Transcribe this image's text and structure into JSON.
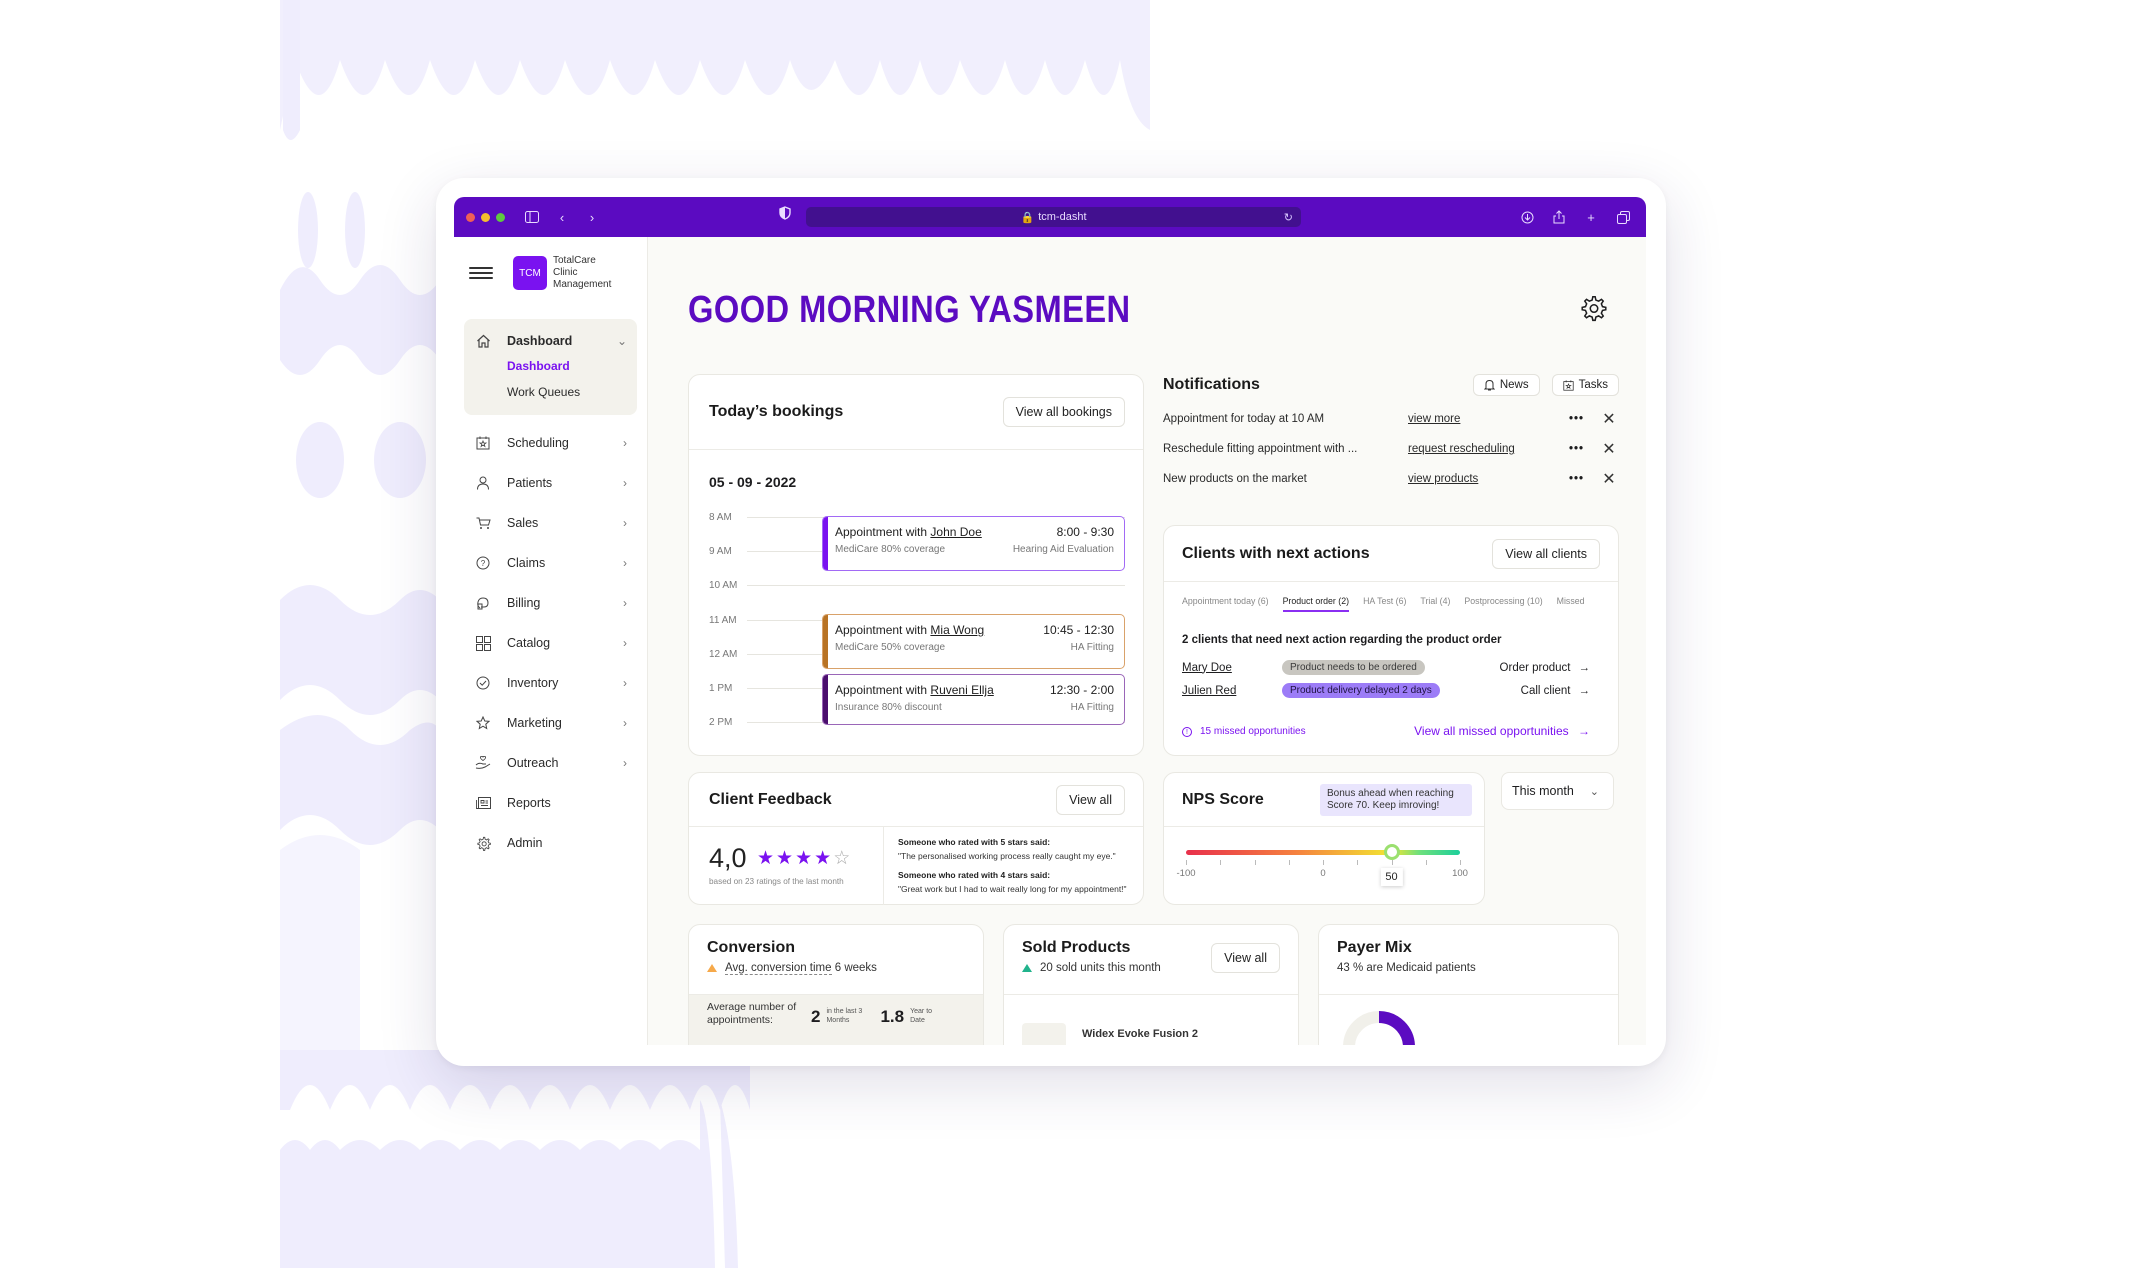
{
  "browser": {
    "url": "tcm-dasht",
    "traffic_lights": [
      "#ee5f57",
      "#f5bd2f",
      "#5fc841"
    ],
    "accent": "#5b0bc1"
  },
  "brand": {
    "logo_text": "TCM",
    "name_line1": "TotalCare",
    "name_line2": "Clinic",
    "name_line3": "Management"
  },
  "sidebar": {
    "group": {
      "label": "Dashboard",
      "icon": "home-icon",
      "children": [
        {
          "label": "Dashboard",
          "active": true
        },
        {
          "label": "Work Queues",
          "active": false
        }
      ]
    },
    "items": [
      {
        "label": "Scheduling",
        "icon": "calendar-star-icon",
        "chevron": true
      },
      {
        "label": "Patients",
        "icon": "person-icon",
        "chevron": true
      },
      {
        "label": "Sales",
        "icon": "cart-icon",
        "chevron": true
      },
      {
        "label": "Claims",
        "icon": "question-circle-icon",
        "chevron": true
      },
      {
        "label": "Billing",
        "icon": "billing-icon",
        "chevron": true
      },
      {
        "label": "Catalog",
        "icon": "grid-icon",
        "chevron": true
      },
      {
        "label": "Inventory",
        "icon": "check-circle-icon",
        "chevron": true
      },
      {
        "label": "Marketing",
        "icon": "star-icon",
        "chevron": true
      },
      {
        "label": "Outreach",
        "icon": "hand-heart-icon",
        "chevron": true
      },
      {
        "label": "Reports",
        "icon": "report-icon",
        "chevron": false
      },
      {
        "label": "Admin",
        "icon": "gear-icon",
        "chevron": false
      }
    ]
  },
  "header": {
    "greeting": "GOOD MORNING YASMEEN"
  },
  "bookings": {
    "title": "Today’s bookings",
    "view_all": "View all bookings",
    "date": "05 - 09 - 2022",
    "hours": [
      "8 AM",
      "9 AM",
      "10 AM",
      "11 AM",
      "12 AM",
      "1 PM",
      "2 PM"
    ],
    "appointments": [
      {
        "prefix": "Appointment with",
        "name": "John Doe",
        "time": "8:00 - 9:30",
        "coverage": "MediCare 80% coverage",
        "type": "Hearing Aid Evaluation",
        "color": "#7a12f0",
        "border": "#a26af5"
      },
      {
        "prefix": "Appointment with",
        "name": "Mia Wong",
        "time": "10:45 - 12:30",
        "coverage": "MediCare 50% coverage",
        "type": "HA Fitting",
        "color": "#b87324",
        "border": "#d9a26a"
      },
      {
        "prefix": "Appointment with",
        "name": "Ruveni Ellja",
        "time": "12:30 - 2:00",
        "coverage": "Insurance 80% discount",
        "type": "HA Fitting",
        "color": "#4b0e6e",
        "border": "#9a66b8"
      }
    ]
  },
  "notifications": {
    "title": "Notifications",
    "news_label": "News",
    "tasks_label": "Tasks",
    "items": [
      {
        "text": "Appointment for today at 10 AM",
        "link": "view more"
      },
      {
        "text": "Reschedule fitting appointment with ...",
        "link": "request rescheduling"
      },
      {
        "text": "New products on the market",
        "link": "view products"
      }
    ]
  },
  "clients": {
    "title": "Clients with next actions",
    "view_all": "View all clients",
    "tabs": [
      {
        "label": "Appointment today (6)",
        "active": false
      },
      {
        "label": "Product order (2)",
        "active": true
      },
      {
        "label": "HA Test (6)",
        "active": false
      },
      {
        "label": "Trial (4)",
        "active": false
      },
      {
        "label": "Postprocessing (10)",
        "active": false
      },
      {
        "label": "Missed",
        "active": false
      }
    ],
    "subtitle": "2 clients that need next action regarding the product order",
    "rows": [
      {
        "name": "Mary Doe",
        "status": "Product needs to be ordered",
        "status_bg": "#c8c6c0",
        "status_fg": "#3a3a3a",
        "action": "Order product"
      },
      {
        "name": "Julien Red",
        "status": "Product delivery delayed 2 days",
        "status_bg": "#9c7cf7",
        "status_fg": "#1e1240",
        "action": "Call client"
      }
    ],
    "missed": "15 missed opportunities",
    "view_missed": "View all missed opportunities"
  },
  "feedback": {
    "title": "Client Feedback",
    "view_all": "View all",
    "rating": "4,0",
    "stars_filled": 4,
    "stars_total": 5,
    "based_on": "based on 23 ratings of the last month",
    "quotes": [
      {
        "title": "Someone who rated with 5 stars said:",
        "text": "\"The personalised working process really caught my eye.\""
      },
      {
        "title": "Someone who rated with 4 stars said:",
        "text": "\"Great work but I had to wait really long for my appointment!\""
      }
    ]
  },
  "nps": {
    "title": "NPS Score",
    "bonus": "Bonus ahead when reaching Score 70. Keep imroving!",
    "value": 50,
    "min": -100,
    "max": 100,
    "labels": [
      "-100",
      "0",
      "100"
    ],
    "value_label": "50"
  },
  "period": {
    "selected": "This month"
  },
  "conversion": {
    "title": "Conversion",
    "subtitle_link": "Avg. conversion time",
    "subtitle_value": "6 weeks",
    "avg_label": "Average number of appointments:",
    "value1": "2",
    "value1_caption": "in the last 3 Months",
    "value2": "1.8",
    "value2_caption": "Year to Date"
  },
  "sold": {
    "title": "Sold Products",
    "subtitle": "20 sold units this month",
    "view_all": "View all",
    "first_product": "Widex Evoke Fusion 2"
  },
  "payer": {
    "title": "Payer Mix",
    "subtitle": "43 % are Medicaid patients",
    "medicaid_share": 0.43
  }
}
